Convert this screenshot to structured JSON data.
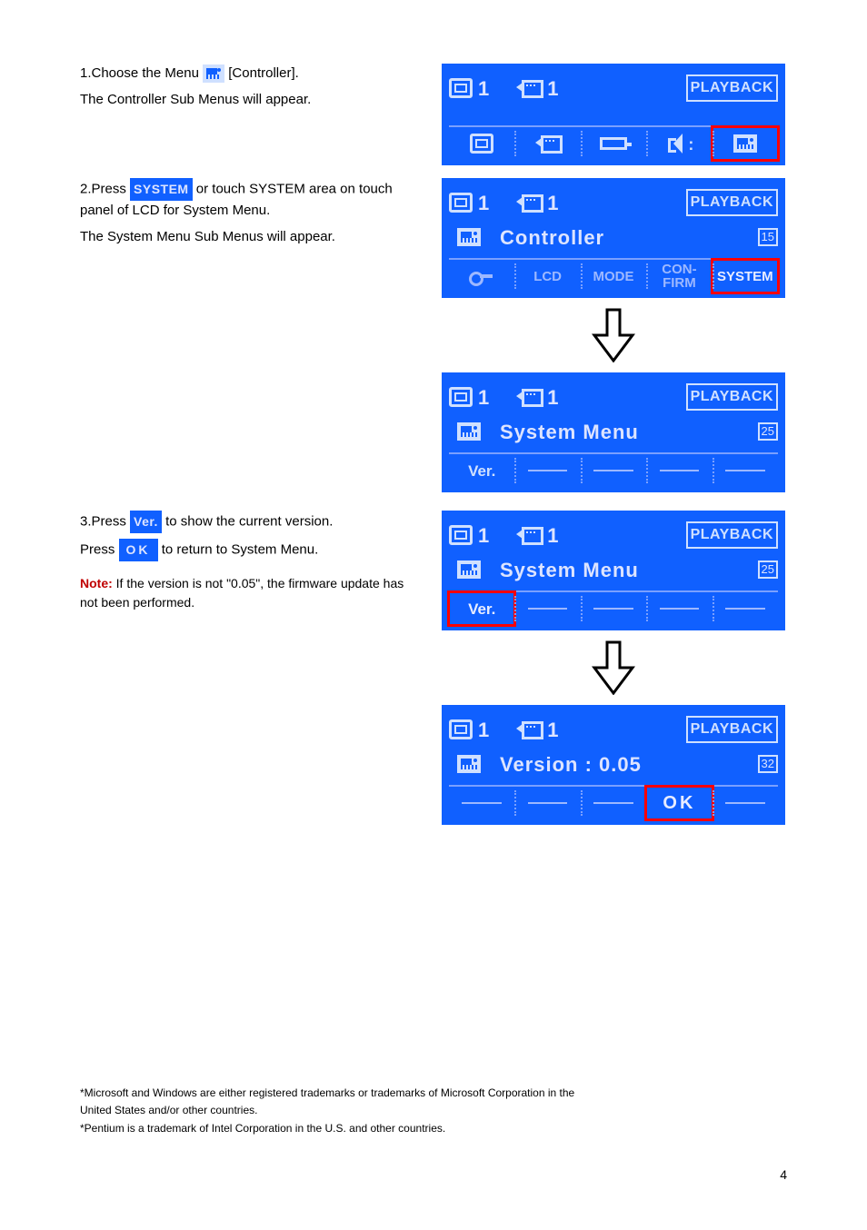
{
  "step1": {
    "intro": "1.Choose the Menu ",
    "text_after_icon": " [Controller].",
    "text_follow": "The Controller Sub Menus will appear."
  },
  "step2": {
    "intro": "2.Press ",
    "label": "SYSTEM",
    "text_after": " or touch SYSTEM area on touch panel of LCD for System Menu.",
    "text_follow": "The System Menu Sub Menus will appear."
  },
  "step3": {
    "intro": "3.Press ",
    "label_ver": "Ver.",
    "text_after_ver": " to show the current version.",
    "text_press": "Press ",
    "label_ok": "OK",
    "text_after_ok": " to return to System Menu."
  },
  "note": {
    "prefix": "Note: ",
    "text": "If the version is not \"0.05\", the firmware update has not been performed."
  },
  "lcd": {
    "playback": "PLAYBACK",
    "one_a": "1",
    "one_b": "1",
    "controller_title": "Controller",
    "controller_page": "15",
    "system_menu_title": "System Menu",
    "system_menu_page": "25",
    "version_title": "Version : 0.05",
    "version_page": "32",
    "tabs": {
      "lcd": "LCD",
      "mode": "MODE",
      "confirm_line1": "CON-",
      "confirm_line2": "FIRM",
      "system": "SYSTEM"
    },
    "ver": "Ver.",
    "ok": "OK"
  },
  "footer": {
    "l1": "*Microsoft and Windows are either registered trademarks or trademarks of Microsoft Corporation in the",
    "l2": "United States and/or other countries.",
    "l3": "*Pentium is a trademark of Intel Corporation in the U.S. and other countries."
  },
  "page_num": "4"
}
